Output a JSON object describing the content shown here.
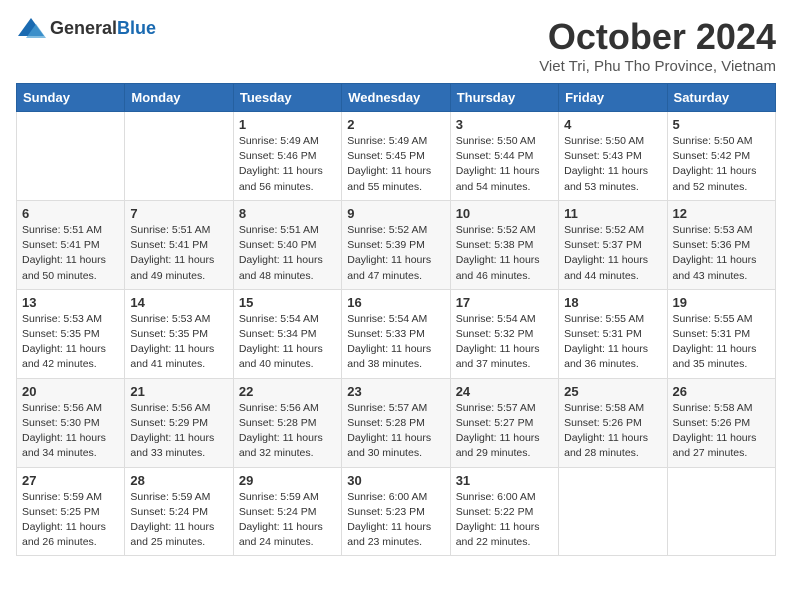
{
  "header": {
    "logo_general": "General",
    "logo_blue": "Blue",
    "month_title": "October 2024",
    "location": "Viet Tri, Phu Tho Province, Vietnam"
  },
  "days_of_week": [
    "Sunday",
    "Monday",
    "Tuesday",
    "Wednesday",
    "Thursday",
    "Friday",
    "Saturday"
  ],
  "weeks": [
    [
      {
        "day": "",
        "info": ""
      },
      {
        "day": "",
        "info": ""
      },
      {
        "day": "1",
        "sunrise": "5:49 AM",
        "sunset": "5:46 PM",
        "daylight": "11 hours and 56 minutes."
      },
      {
        "day": "2",
        "sunrise": "5:49 AM",
        "sunset": "5:45 PM",
        "daylight": "11 hours and 55 minutes."
      },
      {
        "day": "3",
        "sunrise": "5:50 AM",
        "sunset": "5:44 PM",
        "daylight": "11 hours and 54 minutes."
      },
      {
        "day": "4",
        "sunrise": "5:50 AM",
        "sunset": "5:43 PM",
        "daylight": "11 hours and 53 minutes."
      },
      {
        "day": "5",
        "sunrise": "5:50 AM",
        "sunset": "5:42 PM",
        "daylight": "11 hours and 52 minutes."
      }
    ],
    [
      {
        "day": "6",
        "sunrise": "5:51 AM",
        "sunset": "5:41 PM",
        "daylight": "11 hours and 50 minutes."
      },
      {
        "day": "7",
        "sunrise": "5:51 AM",
        "sunset": "5:41 PM",
        "daylight": "11 hours and 49 minutes."
      },
      {
        "day": "8",
        "sunrise": "5:51 AM",
        "sunset": "5:40 PM",
        "daylight": "11 hours and 48 minutes."
      },
      {
        "day": "9",
        "sunrise": "5:52 AM",
        "sunset": "5:39 PM",
        "daylight": "11 hours and 47 minutes."
      },
      {
        "day": "10",
        "sunrise": "5:52 AM",
        "sunset": "5:38 PM",
        "daylight": "11 hours and 46 minutes."
      },
      {
        "day": "11",
        "sunrise": "5:52 AM",
        "sunset": "5:37 PM",
        "daylight": "11 hours and 44 minutes."
      },
      {
        "day": "12",
        "sunrise": "5:53 AM",
        "sunset": "5:36 PM",
        "daylight": "11 hours and 43 minutes."
      }
    ],
    [
      {
        "day": "13",
        "sunrise": "5:53 AM",
        "sunset": "5:35 PM",
        "daylight": "11 hours and 42 minutes."
      },
      {
        "day": "14",
        "sunrise": "5:53 AM",
        "sunset": "5:35 PM",
        "daylight": "11 hours and 41 minutes."
      },
      {
        "day": "15",
        "sunrise": "5:54 AM",
        "sunset": "5:34 PM",
        "daylight": "11 hours and 40 minutes."
      },
      {
        "day": "16",
        "sunrise": "5:54 AM",
        "sunset": "5:33 PM",
        "daylight": "11 hours and 38 minutes."
      },
      {
        "day": "17",
        "sunrise": "5:54 AM",
        "sunset": "5:32 PM",
        "daylight": "11 hours and 37 minutes."
      },
      {
        "day": "18",
        "sunrise": "5:55 AM",
        "sunset": "5:31 PM",
        "daylight": "11 hours and 36 minutes."
      },
      {
        "day": "19",
        "sunrise": "5:55 AM",
        "sunset": "5:31 PM",
        "daylight": "11 hours and 35 minutes."
      }
    ],
    [
      {
        "day": "20",
        "sunrise": "5:56 AM",
        "sunset": "5:30 PM",
        "daylight": "11 hours and 34 minutes."
      },
      {
        "day": "21",
        "sunrise": "5:56 AM",
        "sunset": "5:29 PM",
        "daylight": "11 hours and 33 minutes."
      },
      {
        "day": "22",
        "sunrise": "5:56 AM",
        "sunset": "5:28 PM",
        "daylight": "11 hours and 32 minutes."
      },
      {
        "day": "23",
        "sunrise": "5:57 AM",
        "sunset": "5:28 PM",
        "daylight": "11 hours and 30 minutes."
      },
      {
        "day": "24",
        "sunrise": "5:57 AM",
        "sunset": "5:27 PM",
        "daylight": "11 hours and 29 minutes."
      },
      {
        "day": "25",
        "sunrise": "5:58 AM",
        "sunset": "5:26 PM",
        "daylight": "11 hours and 28 minutes."
      },
      {
        "day": "26",
        "sunrise": "5:58 AM",
        "sunset": "5:26 PM",
        "daylight": "11 hours and 27 minutes."
      }
    ],
    [
      {
        "day": "27",
        "sunrise": "5:59 AM",
        "sunset": "5:25 PM",
        "daylight": "11 hours and 26 minutes."
      },
      {
        "day": "28",
        "sunrise": "5:59 AM",
        "sunset": "5:24 PM",
        "daylight": "11 hours and 25 minutes."
      },
      {
        "day": "29",
        "sunrise": "5:59 AM",
        "sunset": "5:24 PM",
        "daylight": "11 hours and 24 minutes."
      },
      {
        "day": "30",
        "sunrise": "6:00 AM",
        "sunset": "5:23 PM",
        "daylight": "11 hours and 23 minutes."
      },
      {
        "day": "31",
        "sunrise": "6:00 AM",
        "sunset": "5:22 PM",
        "daylight": "11 hours and 22 minutes."
      },
      {
        "day": "",
        "info": ""
      },
      {
        "day": "",
        "info": ""
      }
    ]
  ],
  "labels": {
    "sunrise_prefix": "Sunrise: ",
    "sunset_prefix": "Sunset: ",
    "daylight_label": "Daylight: "
  }
}
